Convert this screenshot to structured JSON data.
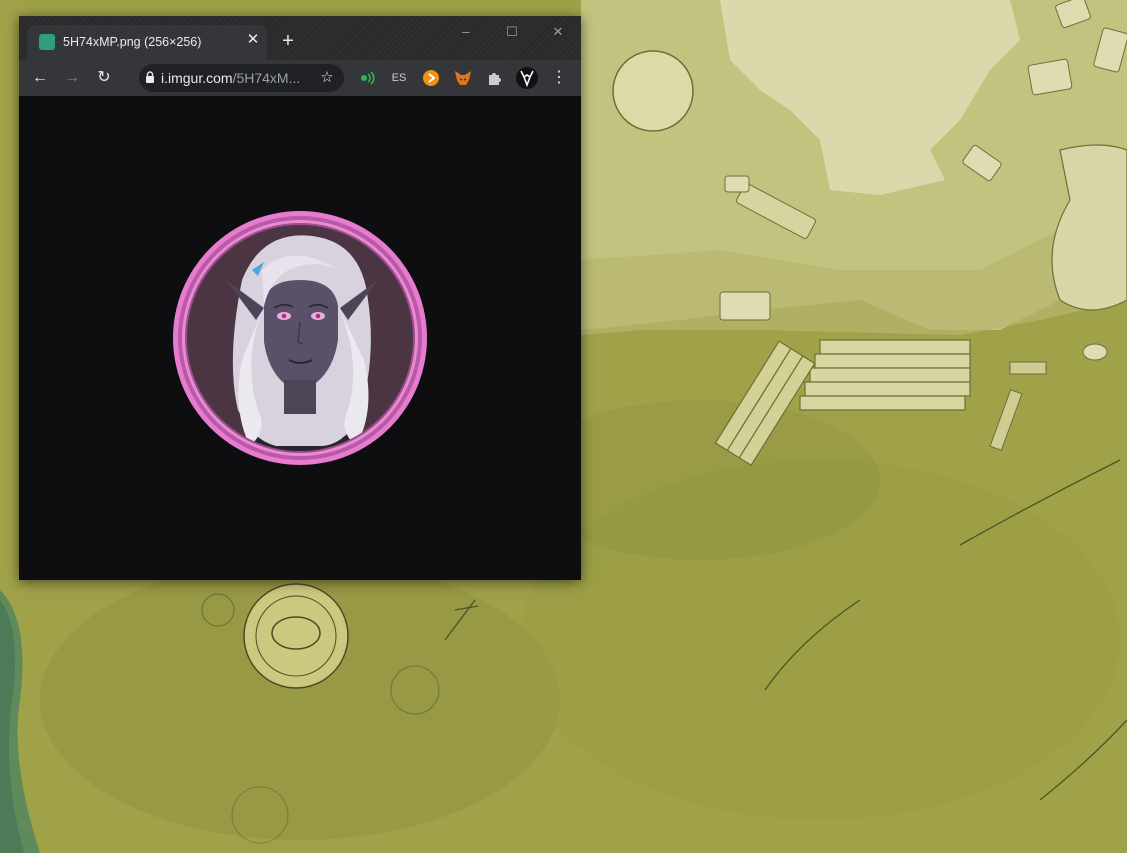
{
  "desktop": {
    "description_name": "fantasy-map-wallpaper"
  },
  "window": {
    "tab": {
      "title": "5H74xMP.png (256×256)",
      "favicon": "imgur-icon"
    },
    "controls": {
      "minimize": "–",
      "maximize": "☐",
      "close": "✕"
    },
    "toolbar": {
      "back": "←",
      "forward": "→",
      "reload": "↻",
      "url_host": "i.imgur.com",
      "url_path": "/5H74xM...",
      "bookmark": "☆",
      "extensions": {
        "es_label": "ES"
      },
      "menu": "⋮"
    }
  },
  "colors": {
    "avatar_ring": "#e77bcf",
    "window_bg": "#0e0e10",
    "map_grass": "#9ea04a"
  }
}
